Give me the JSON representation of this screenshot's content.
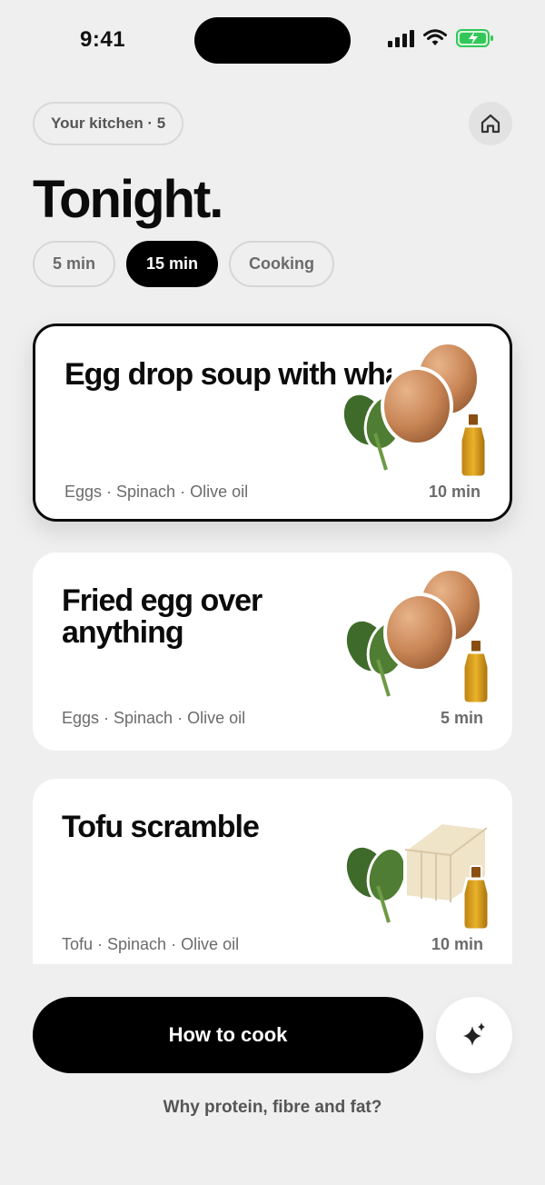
{
  "status": {
    "time": "9:41"
  },
  "header": {
    "kitchen_label": "Your kitchen · 5",
    "title": "Tonight."
  },
  "filters": [
    {
      "label": "5 min",
      "active": false
    },
    {
      "label": "15 min",
      "active": true
    },
    {
      "label": "Cooking",
      "active": false
    }
  ],
  "cards": [
    {
      "title": "Egg drop soup with whatever veg",
      "ingredients": "Eggs · Spinach · Olive oil",
      "time": "10 min",
      "icons": [
        "spinach-icon",
        "eggs-icon",
        "olive-oil-icon"
      ]
    },
    {
      "title": "Fried egg over anything",
      "ingredients": "Eggs · Spinach · Olive oil",
      "time": "5 min",
      "icons": [
        "spinach-icon",
        "eggs-icon",
        "olive-oil-icon"
      ]
    },
    {
      "title": "Tofu scramble",
      "ingredients": "Tofu · Spinach · Olive oil",
      "time": "10 min",
      "icons": [
        "spinach-icon",
        "tofu-icon",
        "olive-oil-icon"
      ]
    }
  ],
  "actions": {
    "cook_label": "How to cook",
    "why_label": "Why protein, fibre and fat?"
  },
  "colors": {
    "background": "#efefef",
    "primary": "#000000",
    "battery": "#33c759"
  }
}
